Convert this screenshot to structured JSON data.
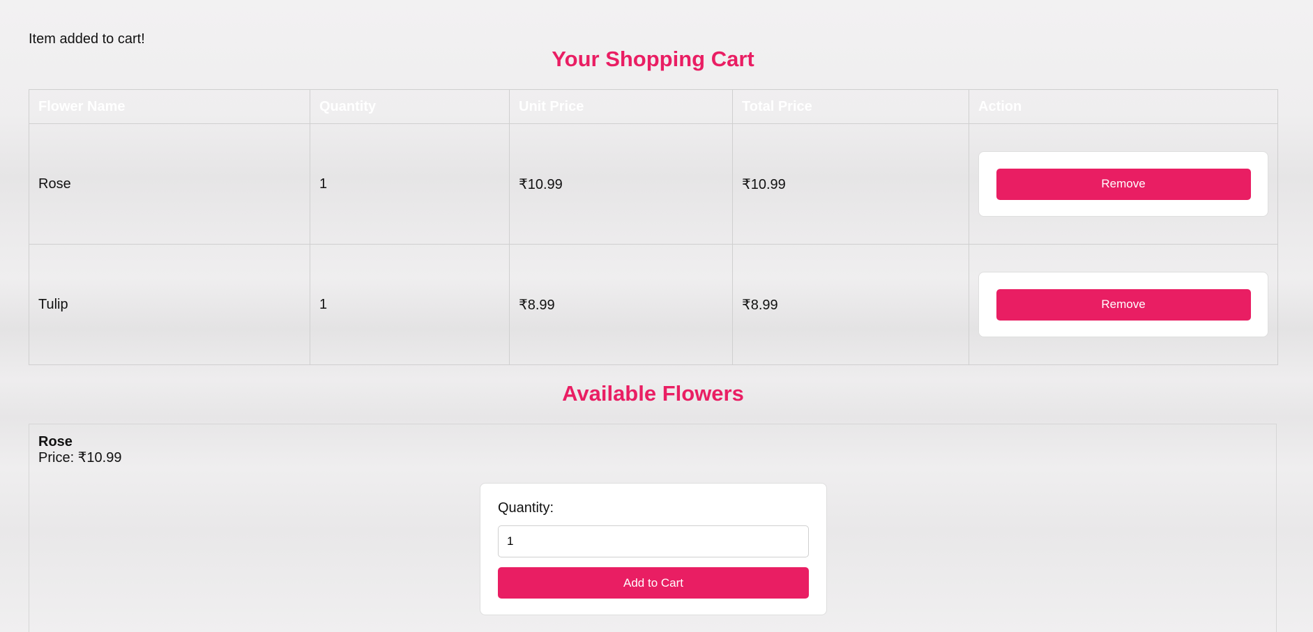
{
  "flash_message": "Item added to cart!",
  "cart": {
    "title": "Your Shopping Cart",
    "columns": [
      "Flower Name",
      "Quantity",
      "Unit Price",
      "Total Price",
      "Action"
    ],
    "rows": [
      {
        "name": "Rose",
        "quantity": "1",
        "unit_price": "₹10.99",
        "total_price": "₹10.99",
        "action_label": "Remove"
      },
      {
        "name": "Tulip",
        "quantity": "1",
        "unit_price": "₹8.99",
        "total_price": "₹8.99",
        "action_label": "Remove"
      }
    ]
  },
  "available": {
    "title": "Available Flowers",
    "items": [
      {
        "name": "Rose",
        "price_text": "Price: ₹10.99",
        "quantity_label": "Quantity:",
        "quantity_value": "1",
        "add_label": "Add to Cart"
      }
    ]
  },
  "colors": {
    "accent": "#e91e63",
    "card_background": "#ffffff",
    "border": "#cfcfcf"
  }
}
